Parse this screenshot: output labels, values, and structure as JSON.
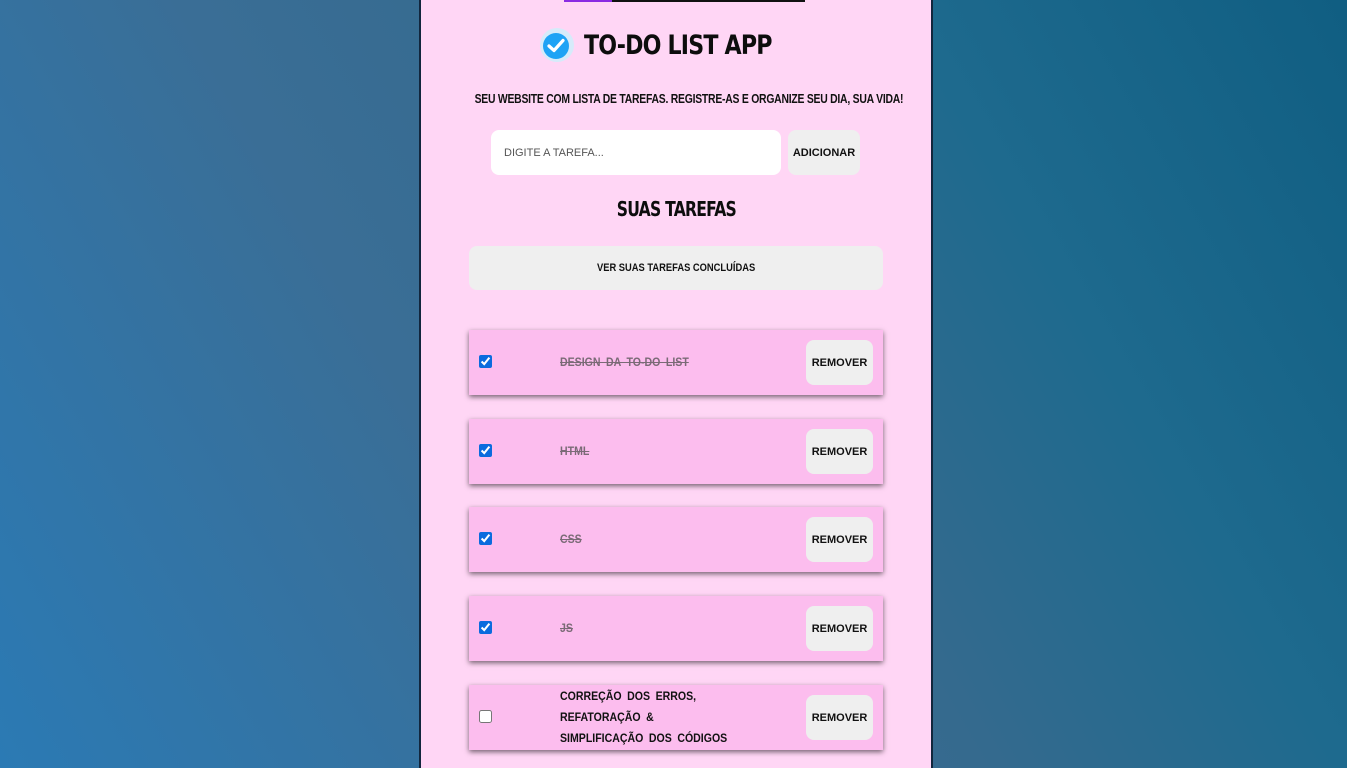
{
  "app": {
    "title": "TO-DO LIST APP",
    "subtitle": "SEU WEBSITE COM LISTA DE TAREFAS. REGISTRE-AS E ORGANIZE SEU DIA, SUA VIDA!",
    "accent_color": "#1ea3f5",
    "panel_color": "#ffd6f5",
    "task_color": "#fcbdee"
  },
  "form": {
    "input_placeholder": "DIGITE A TAREFA...",
    "input_value": "",
    "add_label": "ADICIONAR"
  },
  "tasks_section": {
    "heading": "SUAS TAREFAS",
    "completed_button_label": "VER SUAS TAREFAS CONCLUÍDAS"
  },
  "tasks": [
    {
      "label": "DESIGN DA TO-DO LIST",
      "completed": true,
      "remove_label": "REMOVER"
    },
    {
      "label": "HTML",
      "completed": true,
      "remove_label": "REMOVER"
    },
    {
      "label": "CSS",
      "completed": true,
      "remove_label": "REMOVER"
    },
    {
      "label": "JS",
      "completed": true,
      "remove_label": "REMOVER"
    },
    {
      "label": "CORREÇÃO DOS ERROS, REFATORAÇÃO & SIMPLIFICAÇÃO DOS CÓDIGOS",
      "completed": false,
      "remove_label": "REMOVER"
    }
  ]
}
